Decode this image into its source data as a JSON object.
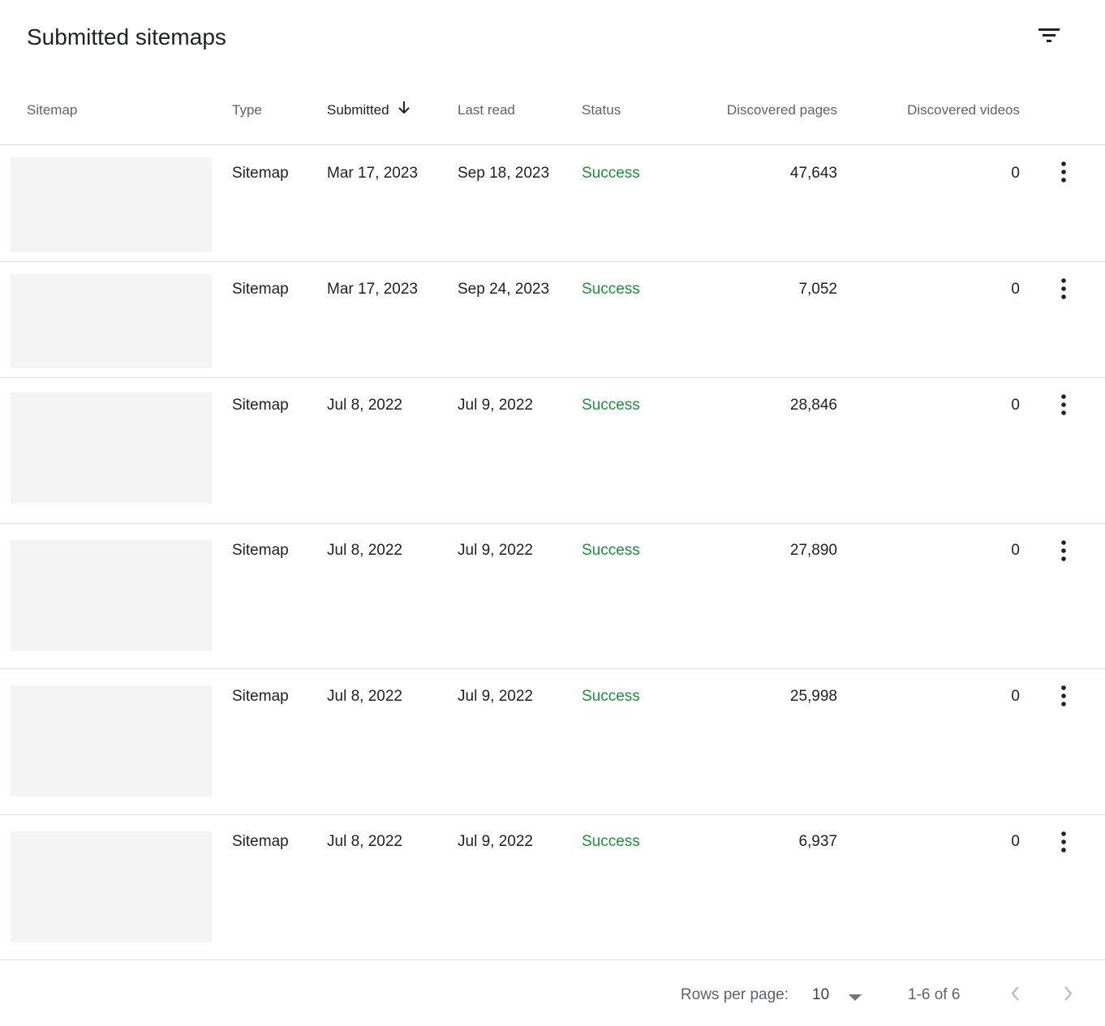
{
  "card": {
    "title": "Submitted sitemaps",
    "filter_icon": "filter-list-icon"
  },
  "table": {
    "columns": [
      {
        "key": "sitemap",
        "label": "Sitemap"
      },
      {
        "key": "type",
        "label": "Type"
      },
      {
        "key": "submitted",
        "label": "Submitted",
        "sorted": "descending"
      },
      {
        "key": "last_read",
        "label": "Last read"
      },
      {
        "key": "status",
        "label": "Status"
      },
      {
        "key": "discovered_pages",
        "label": "Discovered pages"
      },
      {
        "key": "discovered_videos",
        "label": "Discovered videos"
      }
    ],
    "rows": [
      {
        "type": "Sitemap",
        "submitted": "Mar 17, 2023",
        "last_read": "Sep 18, 2023",
        "status": "Success",
        "discovered_pages": "47,643",
        "discovered_videos": "0"
      },
      {
        "type": "Sitemap",
        "submitted": "Mar 17, 2023",
        "last_read": "Sep 24, 2023",
        "status": "Success",
        "discovered_pages": "7,052",
        "discovered_videos": "0"
      },
      {
        "type": "Sitemap",
        "submitted": "Jul 8, 2022",
        "last_read": "Jul 9, 2022",
        "status": "Success",
        "discovered_pages": "28,846",
        "discovered_videos": "0"
      },
      {
        "type": "Sitemap",
        "submitted": "Jul 8, 2022",
        "last_read": "Jul 9, 2022",
        "status": "Success",
        "discovered_pages": "27,890",
        "discovered_videos": "0"
      },
      {
        "type": "Sitemap",
        "submitted": "Jul 8, 2022",
        "last_read": "Jul 9, 2022",
        "status": "Success",
        "discovered_pages": "25,998",
        "discovered_videos": "0"
      },
      {
        "type": "Sitemap",
        "submitted": "Jul 8, 2022",
        "last_read": "Jul 9, 2022",
        "status": "Success",
        "discovered_pages": "6,937",
        "discovered_videos": "0"
      }
    ]
  },
  "pagination": {
    "rows_per_page_label": "Rows per page:",
    "rows_per_page_value": "10",
    "range_label": "1-6 of 6"
  },
  "colors": {
    "status_success": "#1e8e3e",
    "divider": "#e0e0e0",
    "thumbnail_placeholder": "#f4f4f4"
  }
}
